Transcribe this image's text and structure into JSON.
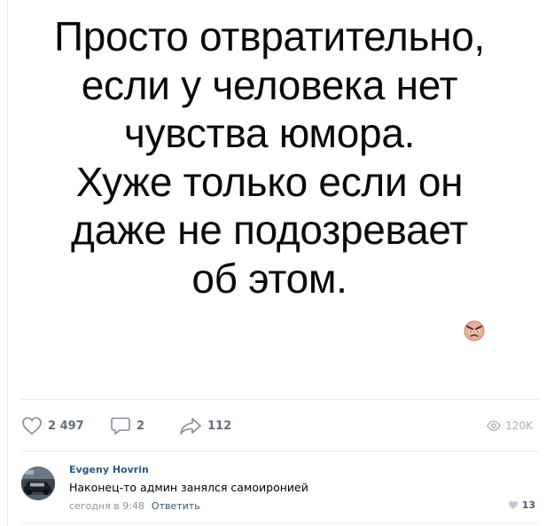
{
  "post": {
    "image_text_lines": [
      "Просто отвратительно,",
      "если у человека нет",
      "чувства юмора.",
      "Хуже только если он",
      "даже не подозревает",
      "об этом."
    ],
    "watermark_icon": "angry-face-icon"
  },
  "actions": {
    "likes": "2 497",
    "comments": "2",
    "shares": "112",
    "views": "120K"
  },
  "comment": {
    "author": "Evgeny Hovrin",
    "text": "Наконец-то админ занялся самоиронией",
    "time": "сегодня в 9:48",
    "reply_label": "Ответить",
    "likes": "13"
  },
  "colors": {
    "link": "#2a5885",
    "muted": "#828a99",
    "divider": "#e7e8ec"
  }
}
